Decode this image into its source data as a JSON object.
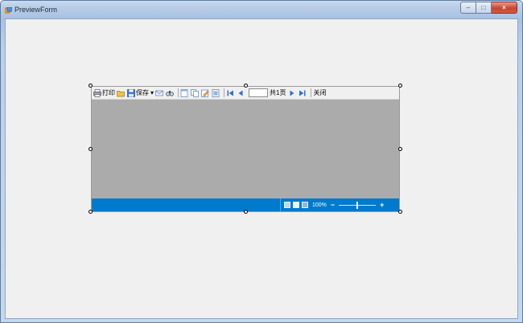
{
  "window": {
    "title": "PreviewForm",
    "icon": "form-app-icon",
    "controls": {
      "minimize": "–",
      "maximize": "□",
      "close": "×"
    }
  },
  "toolbar": {
    "print_label": "打印",
    "save_label": "保存",
    "save_dropdown": "▾",
    "page_value": "",
    "page_total": "共1页",
    "close_label": "关闭",
    "icons": [
      "printer-icon",
      "open-folder-icon",
      "save-icon",
      "email-icon",
      "find-icon",
      "single-page-icon",
      "multi-page-icon",
      "edit-icon",
      "settings-icon",
      "first-page-icon",
      "prev-page-icon",
      "next-page-icon",
      "last-page-icon"
    ]
  },
  "statusbar": {
    "zoom_text": "100%",
    "zoom_minus": "−",
    "zoom_plus": "+",
    "zoom_level": 0.5
  },
  "colors": {
    "accent": "#007acc",
    "page_area": "#ababab",
    "client_bg": "#f0f0f0"
  }
}
